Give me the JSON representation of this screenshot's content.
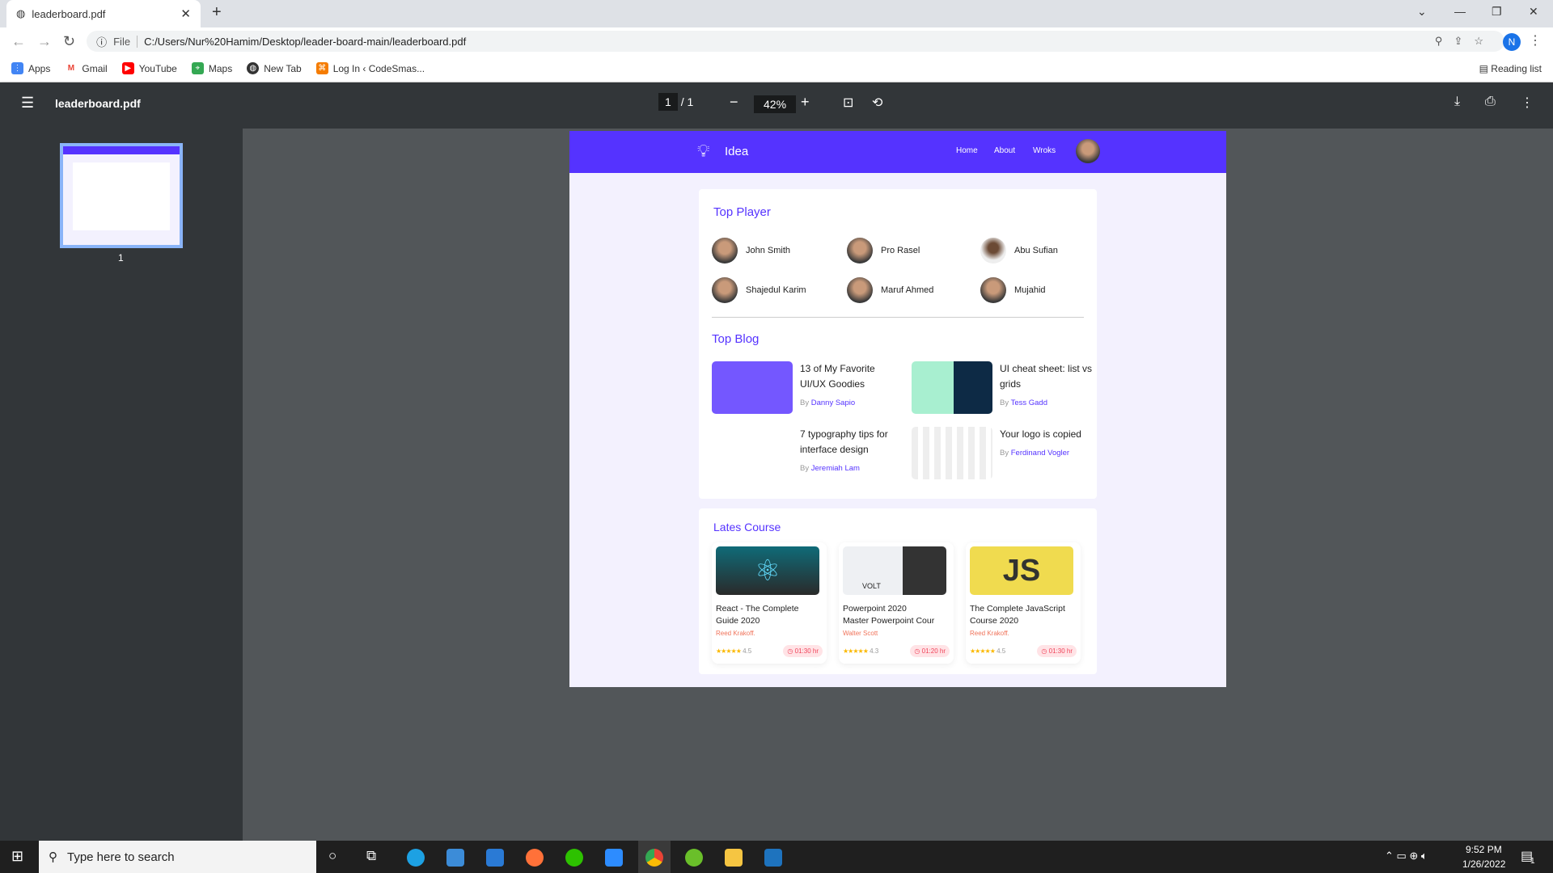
{
  "browser": {
    "tab_title": "leaderboard.pdf",
    "url_scheme": "File",
    "url": "C:/Users/Nur%20Hamim/Desktop/leader-board-main/leaderboard.pdf",
    "profile_initial": "N",
    "bookmarks": [
      "Apps",
      "Gmail",
      "YouTube",
      "Maps",
      "New Tab",
      "Log In ‹ CodeSmas..."
    ],
    "reading_list": "Reading list"
  },
  "pdf": {
    "filename": "leaderboard.pdf",
    "page_current": "1",
    "page_sep": "/",
    "page_total": "1",
    "zoom": "42%",
    "thumb_label": "1"
  },
  "site": {
    "logo": "Idea",
    "nav": [
      "Home",
      "About",
      "Wroks"
    ],
    "top_player_title": "Top Player",
    "players": [
      "John Smith",
      "Pro Rasel",
      "Abu Sufian",
      "Shajedul Karim",
      "Maruf Ahmed",
      "Mujahid"
    ],
    "top_blog_title": "Top Blog",
    "blogs": [
      {
        "title": "13 of My Favorite UI/UX Goodies",
        "by": "By",
        "author": "Danny Sapio"
      },
      {
        "title": "UI cheat sheet: list vs grids",
        "by": "By",
        "author": "Tess Gadd"
      },
      {
        "title": "7 typography tips for interface design",
        "by": "By",
        "author": "Jeremiah Lam"
      },
      {
        "title": "Your logo is copied",
        "by": "By",
        "author": "Ferdinand Vogler"
      }
    ],
    "course_title": "Lates Course",
    "courses": [
      {
        "title1": "React - The Complete",
        "title2": "Guide 2020",
        "author": "Reed Krakoff.",
        "stars": "★★★★★",
        "rating": "4.5",
        "duration": "01:30 hr",
        "img_text": "⚛"
      },
      {
        "title1": "Powerpoint 2020",
        "title2": "Master Powerpoint Cour",
        "author": "Walter Scott",
        "stars": "★★★★★",
        "rating": "4.3",
        "duration": "01:20 hr",
        "img_text": "VOLT"
      },
      {
        "title1": "The Complete JavaScript",
        "title2": "Course 2020",
        "author": "Reed Krakoff.",
        "stars": "★★★★★",
        "rating": "4.5",
        "duration": "01:30 hr",
        "img_text": "JS"
      }
    ]
  },
  "taskbar": {
    "search_placeholder": "Type here to search",
    "time": "9:52 PM",
    "date": "1/26/2022",
    "notifications": "1"
  },
  "colors": {
    "brand": "#5533ff",
    "page_bg": "#f3f1fe",
    "duration_badge": "#ffe3e6",
    "author_course": "#f0735a"
  }
}
